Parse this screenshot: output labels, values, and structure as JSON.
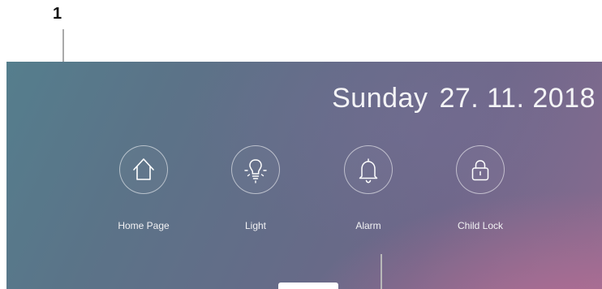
{
  "callouts": {
    "number": "1"
  },
  "header": {
    "day": "Sunday",
    "date": "27. 11. 2018"
  },
  "tiles": [
    {
      "label": "Home Page",
      "icon": "home-icon"
    },
    {
      "label": "Light",
      "icon": "lightbulb-icon"
    },
    {
      "label": "Alarm",
      "icon": "bell-icon"
    },
    {
      "label": "Child Lock",
      "icon": "lock-icon"
    }
  ],
  "colors": {
    "text": "#f4f4f6",
    "icon_stroke": "#ffffff",
    "callout_line": "#a9a9a9"
  }
}
